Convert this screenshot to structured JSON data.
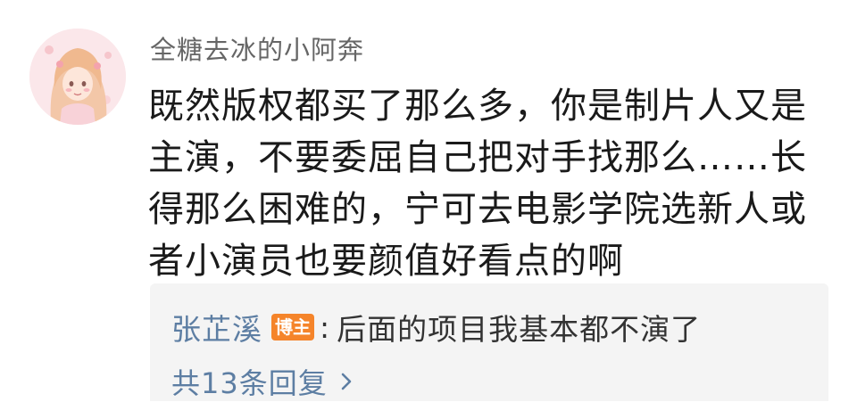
{
  "comment": {
    "username": "全糖去冰的小阿奔",
    "text": "既然版权都买了那么多，你是制片人又是主演，不要委屈自己把对手找那么……长得那么困难的，宁可去电影学院选新人或者小演员也要颜值好看点的啊",
    "avatar_icon": "avatar-girl-illustration"
  },
  "reply": {
    "author": "张芷溪",
    "badge": "博主",
    "colon": ":",
    "text": "后面的项目我基本都不演了",
    "more_label": "共13条回复",
    "more_icon": "chevron-right-icon"
  },
  "colors": {
    "link": "#5d7ea3",
    "badge": "#f5842a",
    "reply_background": "#f4f4f4"
  }
}
